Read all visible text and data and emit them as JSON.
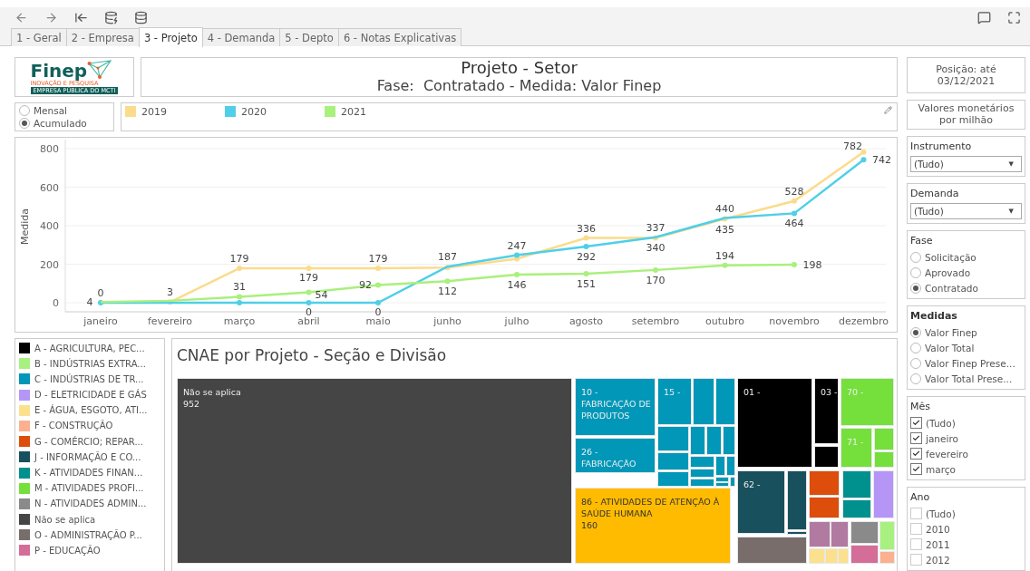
{
  "tabs": [
    {
      "label": "1 - Geral",
      "selected": false
    },
    {
      "label": "2 - Empresa",
      "selected": false
    },
    {
      "label": "3 - Projeto",
      "selected": true
    },
    {
      "label": "4 - Demanda",
      "selected": false
    },
    {
      "label": "5 - Depto",
      "selected": false
    },
    {
      "label": "6 - Notas Explicativas",
      "selected": false
    }
  ],
  "logo": {
    "name": "Finep",
    "tagline": "INOVAÇÃO E PESQUISA",
    "footer": "EMPRESA PÚBLICA DO MCTI"
  },
  "header": {
    "title": "Projeto - Setor",
    "subtitle": "Fase:  Contratado - Medida: Valor Finep"
  },
  "period_options": [
    {
      "label": "Mensal",
      "selected": false
    },
    {
      "label": "Acumulado",
      "selected": true
    }
  ],
  "chart": {
    "chart_data": {
      "type": "line",
      "ylabel": "Medida",
      "categories": [
        "janeiro",
        "fevereiro",
        "março",
        "abril",
        "maio",
        "junho",
        "julho",
        "agosto",
        "setembro",
        "outubro",
        "novembro",
        "dezembro"
      ],
      "ylim": [
        0,
        800
      ],
      "yticks": [
        0,
        200,
        400,
        600,
        800
      ],
      "data_labels": true,
      "grid": true,
      "series": [
        {
          "name": "2019",
          "color": "#fbdb8c",
          "marker": true,
          "values": [
            null,
            3,
            179,
            179,
            179,
            182,
            228,
            336,
            337,
            435,
            528,
            782
          ],
          "value_labels": [
            null,
            "3",
            "179",
            "179",
            "179",
            null,
            null,
            "336",
            "337",
            "435",
            "528",
            "782"
          ]
        },
        {
          "name": "2020",
          "color": "#4fcfe8",
          "marker": true,
          "values": [
            0,
            0,
            0,
            0,
            0,
            187,
            247,
            292,
            340,
            440,
            464,
            742
          ],
          "value_labels": [
            "0",
            null,
            null,
            "0",
            "0",
            "187",
            "247",
            "292",
            "340",
            "440",
            "464",
            "742"
          ]
        },
        {
          "name": "2021",
          "color": "#a9f07c",
          "marker": true,
          "values": [
            4,
            10,
            31,
            54,
            92,
            112,
            146,
            151,
            170,
            194,
            198,
            null
          ],
          "value_labels": [
            "4",
            null,
            "31",
            "54",
            "92",
            "112",
            "146",
            "151",
            "170",
            "194",
            "198",
            null
          ]
        }
      ]
    }
  },
  "sector_legend": [
    {
      "label": "A - AGRICULTURA, PEC...",
      "color": "#000000"
    },
    {
      "label": "B - INDÚSTRIAS EXTRA...",
      "color": "#a8f080"
    },
    {
      "label": "C - INDÚSTRIAS DE TR...",
      "color": "#0097b8"
    },
    {
      "label": "D - ELETRICIDADE E GÁS",
      "color": "#b596f7"
    },
    {
      "label": "E - ÁGUA, ESGOTO, ATI...",
      "color": "#fbe08e"
    },
    {
      "label": "F - CONSTRUÇÃO",
      "color": "#fbb08e"
    },
    {
      "label": "G - COMÉRCIO; REPAR...",
      "color": "#dd4d0b"
    },
    {
      "label": "J - INFORMAÇÃO E CO...",
      "color": "#18515d"
    },
    {
      "label": "K - ATIVIDADES FINAN...",
      "color": "#00918f"
    },
    {
      "label": "M - ATIVIDADES PROFI...",
      "color": "#75df3c"
    },
    {
      "label": "N - ATIVIDADES ADMIN...",
      "color": "#8a8a8a"
    },
    {
      "label": "Não se aplica",
      "color": "#454545"
    },
    {
      "label": "O - ADMINISTRAÇÃO P...",
      "color": "#786d6b"
    },
    {
      "label": "P - EDUCAÇÃO",
      "color": "#d46d97"
    }
  ],
  "treemap": {
    "title": "CNAE por Projeto - Seção e Divisão",
    "tiles": [
      {
        "label": "Não se aplica",
        "value": "952",
        "color": "#454545"
      },
      {
        "label": "10 - FABRICAÇÃO DE PRODUTOS",
        "color": "#0097b8"
      },
      {
        "label": "26 - FABRICAÇÃO",
        "color": "#0097b8"
      },
      {
        "label": "15 -",
        "color": "#0097b8"
      },
      {
        "label": "86 - ATIVIDADES DE ATENÇÃO À SAÚDE HUMANA",
        "value": "160",
        "color": "#ffbb00"
      },
      {
        "label": "01 -",
        "color": "#000000"
      },
      {
        "label": "03 -",
        "color": "#000000"
      },
      {
        "label": "70 -",
        "color": "#75df3c"
      },
      {
        "label": "71 -",
        "color": "#75df3c"
      },
      {
        "label": "62 -",
        "color": "#18515d"
      }
    ]
  },
  "position": "Posição: até 03/12/2021",
  "currency_note": "Valores monetários por milhão",
  "filters": [
    {
      "kind": "dropdown",
      "title": "Instrumento",
      "bold_title": false,
      "value": "(Tudo)",
      "caret": "▼"
    },
    {
      "kind": "dropdown",
      "title": "Demanda",
      "bold_title": false,
      "value": "(Tudo)",
      "caret": "▼"
    },
    {
      "kind": "radio",
      "title": "Fase",
      "bold_title": false,
      "options": [
        {
          "label": "Solicitação",
          "selected": false
        },
        {
          "label": "Aprovado",
          "selected": false
        },
        {
          "label": "Contratado",
          "selected": true
        }
      ]
    },
    {
      "kind": "radio",
      "title": "Medidas",
      "bold_title": true,
      "options": [
        {
          "label": "Valor Finep",
          "selected": true
        },
        {
          "label": "Valor Total",
          "selected": false
        },
        {
          "label": "Valor Finep Prese...",
          "selected": false
        },
        {
          "label": "Valor Total Prese...",
          "selected": false
        }
      ]
    },
    {
      "kind": "checkbox",
      "title": "Mês",
      "bold_title": false,
      "options": [
        {
          "label": "(Tudo)",
          "checked": true
        },
        {
          "label": "janeiro",
          "checked": true
        },
        {
          "label": "fevereiro",
          "checked": true
        },
        {
          "label": "março",
          "checked": true
        }
      ]
    },
    {
      "kind": "checkbox",
      "title": "Ano",
      "bold_title": false,
      "options": [
        {
          "label": "(Tudo)",
          "checked": false
        },
        {
          "label": "2010",
          "checked": false
        },
        {
          "label": "2011",
          "checked": false
        },
        {
          "label": "2012",
          "checked": false
        }
      ]
    }
  ]
}
